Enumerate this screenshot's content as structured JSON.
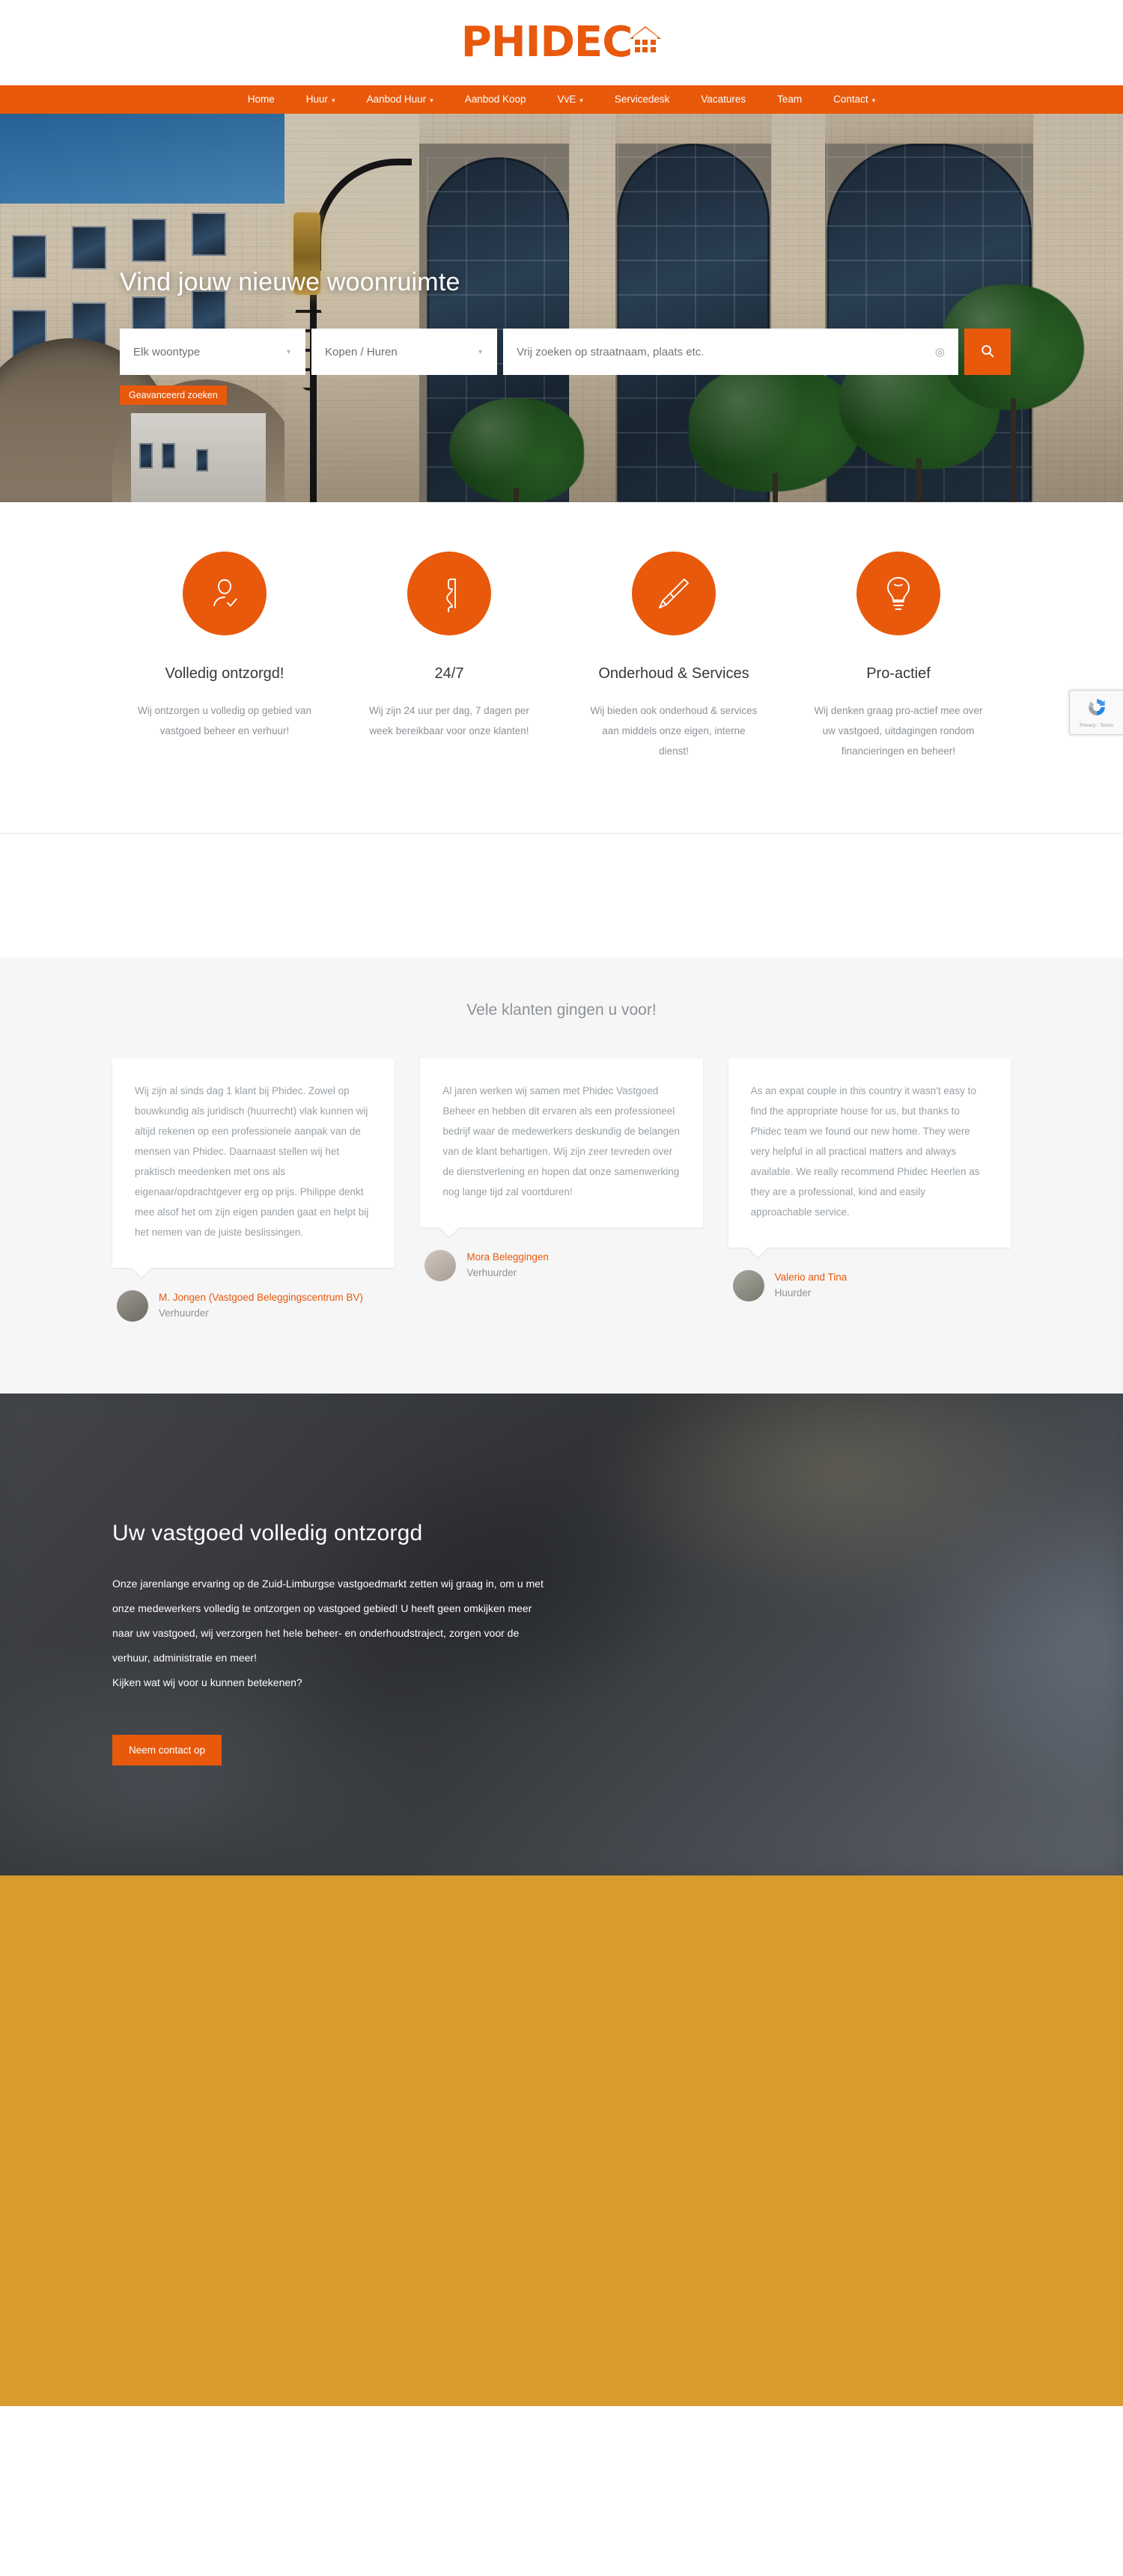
{
  "brand": {
    "name": "PHIDEC",
    "accent_color": "#E8590C",
    "logo_icon": "house-icon"
  },
  "nav": {
    "items": [
      {
        "label": "Home",
        "has_dropdown": false
      },
      {
        "label": "Huur",
        "has_dropdown": true
      },
      {
        "label": "Aanbod Huur",
        "has_dropdown": true
      },
      {
        "label": "Aanbod Koop",
        "has_dropdown": false
      },
      {
        "label": "VvE",
        "has_dropdown": true
      },
      {
        "label": "Servicedesk",
        "has_dropdown": false
      },
      {
        "label": "Vacatures",
        "has_dropdown": false
      },
      {
        "label": "Team",
        "has_dropdown": false
      },
      {
        "label": "Contact",
        "has_dropdown": true
      }
    ]
  },
  "hero": {
    "title": "Vind jouw nieuwe woonruimte",
    "type_select": "Elk woontype",
    "deal_select": "Kopen / Huren",
    "free_text_placeholder": "Vrij zoeken op straatnaam, plaats etc.",
    "free_text_value": "",
    "advanced_label": "Geavanceerd zoeken",
    "search_icon": "magnifier-icon",
    "geo_icon": "target-locate-icon"
  },
  "features": [
    {
      "icon": "person-check-icon",
      "title": "Volledig ontzorgd!",
      "desc": "Wij ontzorgen u volledig op gebied van vastgoed beheer en verhuur!"
    },
    {
      "icon": "phone-handset-icon",
      "title": "24/7",
      "desc": "Wij zijn 24 uur per dag, 7 dagen per week bereikbaar voor onze klanten!"
    },
    {
      "icon": "screwdriver-icon",
      "title": "Onderhoud & Services",
      "desc": "Wij bieden ook onderhoud & services aan middels onze eigen, interne dienst!"
    },
    {
      "icon": "lightbulb-icon",
      "title": "Pro-actief",
      "desc": "Wij denken graag pro-actief mee over uw vastgoed, uitdagingen rondom financieringen en beheer!"
    }
  ],
  "testimonials": {
    "heading": "Vele klanten gingen u voor!",
    "items": [
      {
        "quote": "Wij zijn al sinds dag 1 klant bij Phidec. Zowel op bouwkundig als juridisch (huurrecht) vlak kunnen wij altijd rekenen op een professionele aanpak van de mensen van Phidec. Daarnaast stellen wij het praktisch meedenken met ons als eigenaar/opdrachtgever erg op prijs. Philippe denkt mee alsof het om zijn eigen panden gaat en helpt bij het nemen van de juiste beslissingen.",
        "name": "M. Jongen (Vastgoed Beleggingscentrum BV)",
        "role": "Verhuurder"
      },
      {
        "quote": "Al jaren werken wij samen met Phidec Vastgoed Beheer en hebben dit ervaren als een professioneel bedrijf waar de medewerkers deskundig de belangen van de klant behartigen. Wij zijn zeer tevreden over de dienstverlening en hopen dat onze samenwerking nog lange tijd zal voortduren!",
        "name": "Mora Beleggingen",
        "role": "Verhuurder"
      },
      {
        "quote": "As an expat couple in this country it wasn't easy to find the appropriate house for us, but thanks to Phidec team we found our new home. They were very helpful in all practical matters and always available. We really recommend Phidec Heerlen as they are a professional, kind and easily approachable service.",
        "name": "Valerio and Tina",
        "role": "Huurder"
      }
    ]
  },
  "cta": {
    "title": "Uw vastgoed volledig ontzorgd",
    "body": "Onze jarenlange ervaring op de Zuid-Limburgse vastgoedmarkt zetten wij graag in, om u met onze medewerkers volledig te ontzorgen op vastgoed gebied! U heeft geen omkijken meer naar uw vastgoed, wij verzorgen het hele beheer- en onderhoudstraject, zorgen voor de verhuur, administratie en meer!",
    "body2": "Kijken wat wij voor u kunnen betekenen?",
    "button_label": "Neem contact op"
  },
  "recaptcha": {
    "icon": "recaptcha-icon",
    "terms": "Privacy - Terms"
  }
}
